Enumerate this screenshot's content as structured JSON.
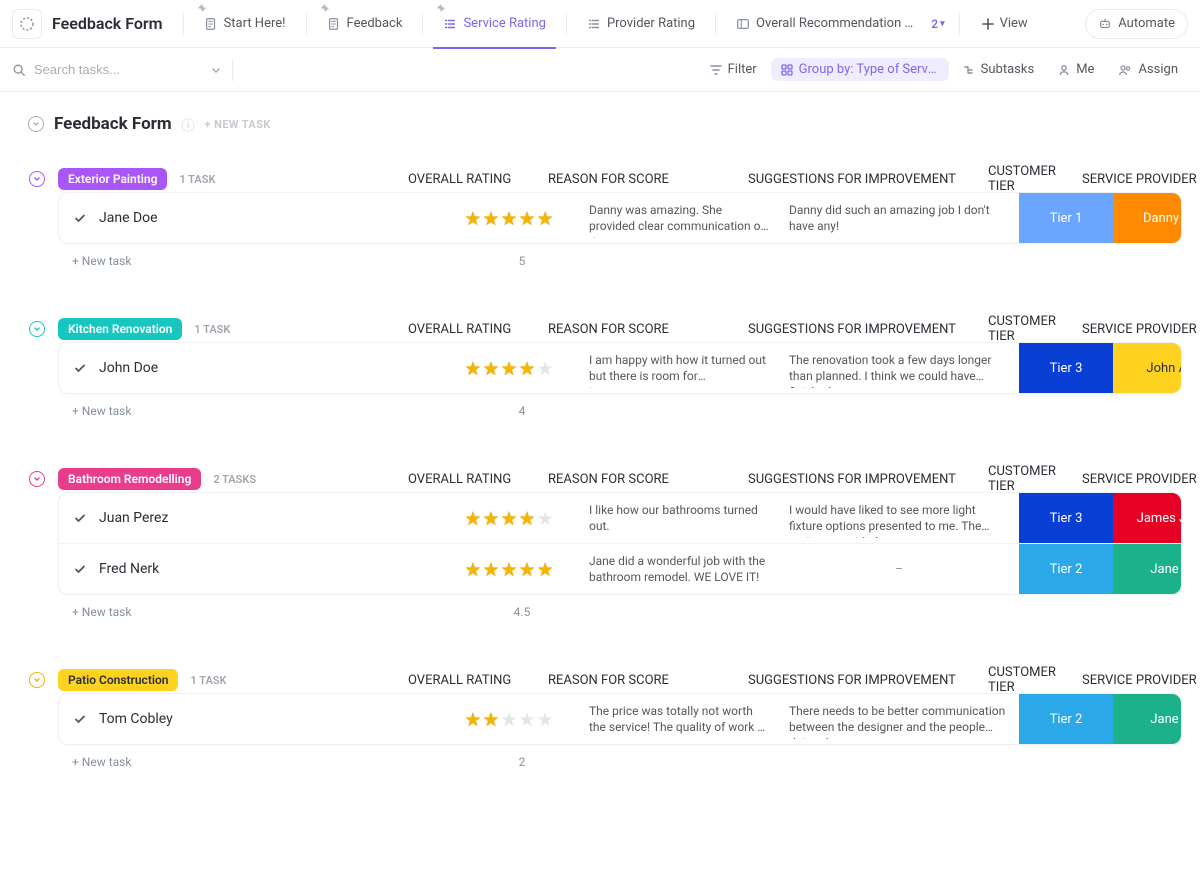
{
  "header": {
    "page_title": "Feedback Form",
    "tabs": [
      {
        "label": "Start Here!"
      },
      {
        "label": "Feedback"
      },
      {
        "label": "Service Rating"
      },
      {
        "label": "Provider Rating"
      },
      {
        "label": "Overall Recommendation …"
      }
    ],
    "hidden_tabs_count": "2",
    "view_label": "View",
    "automate_label": "Automate"
  },
  "toolbar": {
    "search_placeholder": "Search tasks...",
    "filter_label": "Filter",
    "group_label": "Group by: Type of Service…",
    "subtasks_label": "Subtasks",
    "me_label": "Me",
    "assign_label": "Assign"
  },
  "list": {
    "title": "Feedback Form",
    "new_task_label": "+ NEW TASK"
  },
  "columns": {
    "overall": "OVERALL RATING",
    "reason": "REASON FOR SCORE",
    "suggestions": "SUGGESTIONS FOR IMPROVEMENT",
    "tier": "CUSTOMER TIER",
    "provider": "SERVICE PROVIDER"
  },
  "new_task_row": "+ New task",
  "groups": [
    {
      "name": "Exterior Painting",
      "badge_class": "badge-purple",
      "chev_class": "chev-purple",
      "count_label": "1 TASK",
      "avg": "5",
      "rows": [
        {
          "name": "Jane Doe",
          "rating": 5,
          "reason": "Danny was amazing. She provided clear communication of time…",
          "suggestion": "Danny did such an amazing job I don't have any!",
          "tier_label": "Tier 1",
          "tier_class": "tier-1",
          "provider_label": "Danny Rogers",
          "provider_class": "prov-orange"
        }
      ]
    },
    {
      "name": "Kitchen Renovation",
      "badge_class": "badge-teal",
      "chev_class": "chev-teal",
      "count_label": "1 TASK",
      "avg": "4",
      "rows": [
        {
          "name": "John Doe",
          "rating": 4,
          "reason": "I am happy with how it turned out but there is room for improvement",
          "suggestion": "The renovation took a few days longer than planned. I think we could have finished on …",
          "tier_label": "Tier 3",
          "tier_class": "tier-3",
          "provider_label": "John Adams",
          "provider_class": "prov-yellow"
        }
      ]
    },
    {
      "name": "Bathroom Remodelling",
      "badge_class": "badge-pink",
      "chev_class": "chev-pink",
      "count_label": "2 TASKS",
      "avg": "4.5",
      "rows": [
        {
          "name": "Juan Perez",
          "rating": 4,
          "reason": "I like how our bathrooms turned out.",
          "suggestion": "I would have liked to see more light fixture options presented to me. The options provided…",
          "tier_label": "Tier 3",
          "tier_class": "tier-3",
          "provider_label": "James Johnson",
          "provider_class": "prov-red"
        },
        {
          "name": "Fred Nerk",
          "rating": 5,
          "reason": "Jane did a wonderful job with the bathroom remodel. WE LOVE IT!",
          "suggestion": "–",
          "suggestion_dash": true,
          "tier_label": "Tier 2",
          "tier_class": "tier-2",
          "provider_label": "Jane Smith",
          "provider_class": "prov-green"
        }
      ]
    },
    {
      "name": "Patio Construction",
      "badge_class": "badge-yellow",
      "chev_class": "chev-yellow",
      "count_label": "1 TASK",
      "avg": "2",
      "rows": [
        {
          "name": "Tom Cobley",
          "rating": 2,
          "reason": "The price was totally not worth the service! The quality of work …",
          "suggestion": "There needs to be better communication between the designer and the people doing the…",
          "tier_label": "Tier 2",
          "tier_class": "tier-2",
          "provider_label": "Jane Smith",
          "provider_class": "prov-green"
        }
      ]
    }
  ]
}
